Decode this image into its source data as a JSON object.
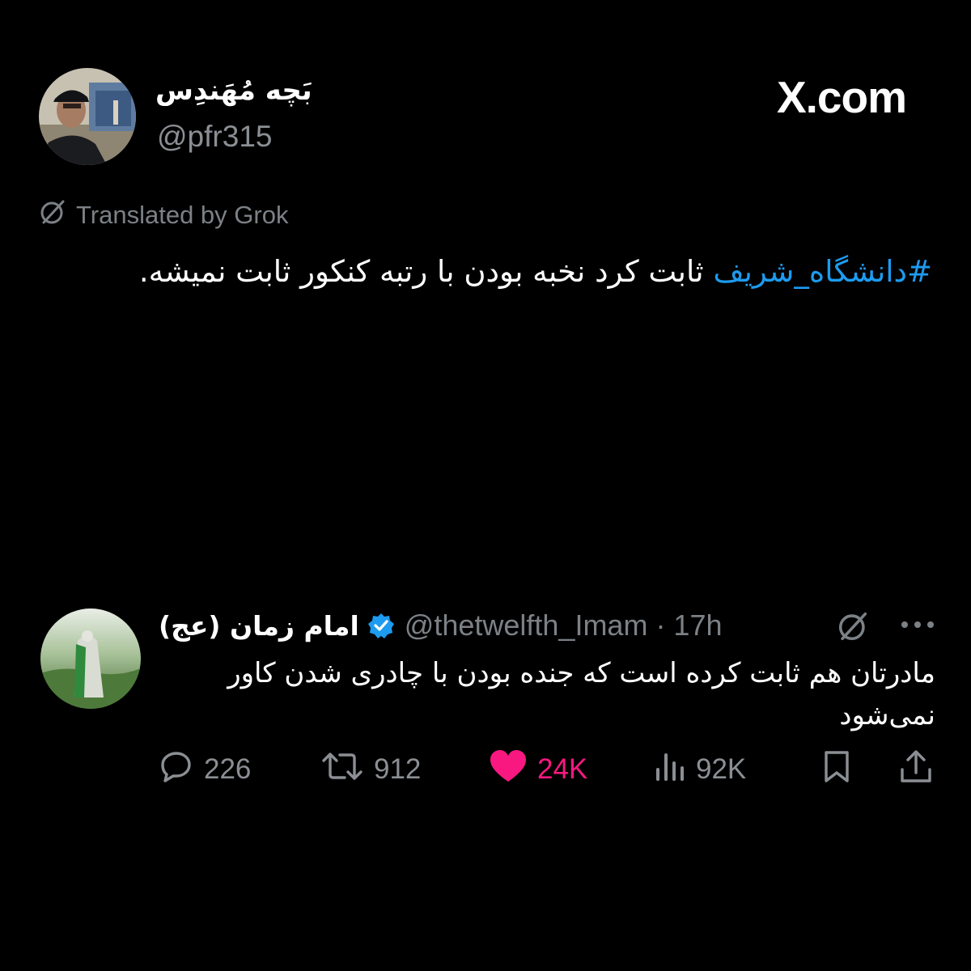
{
  "tweet": {
    "author_name": "بَچه مُهَندِس",
    "handle": "@pfr315",
    "site_label": "X.com",
    "translated_label": "Translated by Grok",
    "hashtag": "#دانشگاه_شریف",
    "text": " ثابت کرد نخبه بودن با رتبه کنکور ثابت نمیشه."
  },
  "reply": {
    "author_name": "امام زمان (عج)",
    "handle": "@thetwelfth_Imam · 17h",
    "text": "مادرتان هم ثابت کرده است که جنده بودن با چادری شدن کاور نمی‌شود",
    "verified": true,
    "actions": {
      "replies": "226",
      "reposts": "912",
      "likes": "24K",
      "views": "92K"
    }
  },
  "colors": {
    "background": "#000000",
    "link": "#1d9bf0",
    "like": "#f91880",
    "muted": "#8b8f94"
  },
  "icons": [
    "grok-icon",
    "verified-badge-icon",
    "more-icon",
    "reply-icon",
    "repost-icon",
    "like-icon",
    "views-icon",
    "bookmark-icon",
    "share-icon"
  ]
}
